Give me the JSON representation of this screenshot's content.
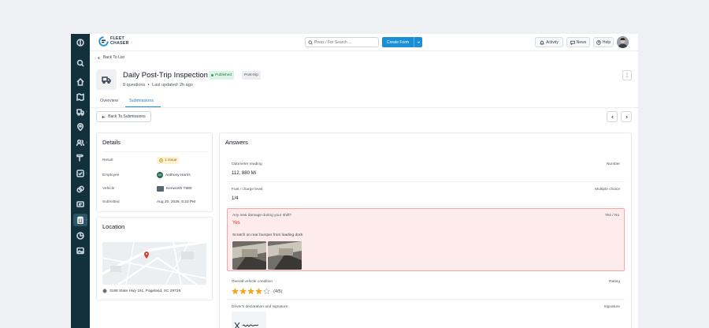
{
  "brand": {
    "line1": "FLEET",
    "line2": "CHASER",
    "accent": "#1a8fd6"
  },
  "topbar": {
    "search_placeholder": "Press / For Search ...",
    "create_label": "Create Form",
    "activity_label": "Activity",
    "news_label": "News",
    "help_label": "Help"
  },
  "nav": {
    "icons": [
      "panel-toggle-icon",
      "search-icon",
      "home-icon",
      "map-icon",
      "truck-icon",
      "location-pin-icon",
      "users-icon",
      "tools-icon",
      "checklist-icon",
      "parts-icon",
      "id-card-icon",
      "clipboard-icon",
      "reports-icon",
      "gallery-icon"
    ],
    "active": "clipboard-icon"
  },
  "page": {
    "back_label": "Back To List",
    "title": "Daily Post-Trip Inspection",
    "status": "Published",
    "category": "Post-trip",
    "questions": "8 questions",
    "bullet": "•",
    "updated": "Last updated: 2h ago",
    "more": "⋮"
  },
  "tabs": [
    "Overview",
    "Submissions"
  ],
  "active_tab": "Submissions",
  "toolbar": {
    "back_submissions": "Back To Submissions"
  },
  "details": {
    "title": "Details",
    "rows": [
      {
        "label": "Result",
        "value": "1 Issue"
      },
      {
        "label": "Employee",
        "value": "Anthony Harris",
        "initials": "AH"
      },
      {
        "label": "Vehicle",
        "value": "Kenworth T880"
      },
      {
        "label": "Submitted",
        "value": "Aug 20, 2026, 6:23 PM"
      }
    ]
  },
  "location": {
    "title": "Location",
    "address": "3188 State Hwy 151, Pageland, SC 29728"
  },
  "answers": {
    "title": "Answers",
    "items": [
      {
        "label": "Odometer reading",
        "type": "Number",
        "value": "112, 880 Mi"
      },
      {
        "label": "Fuel / charge level",
        "type": "Multiple choice",
        "value": "1/4"
      },
      {
        "label": "Any new damage during your shift?",
        "type": "Yes / No",
        "value": "Yes",
        "note": "Scratch on rear bumper from loading dock"
      },
      {
        "label": "Overall vehicle condition",
        "type": "Rating",
        "value": "(4/5)",
        "rating": 4,
        "max": 5
      },
      {
        "label": "Driver's declaration and signature",
        "type": "Signature"
      }
    ]
  },
  "colors": {
    "alert_bg": "#fdeceb",
    "alert_border": "#f1a8a4",
    "alert_text": "#d0312d",
    "star": "#f5a623",
    "rail": "#13303d"
  }
}
